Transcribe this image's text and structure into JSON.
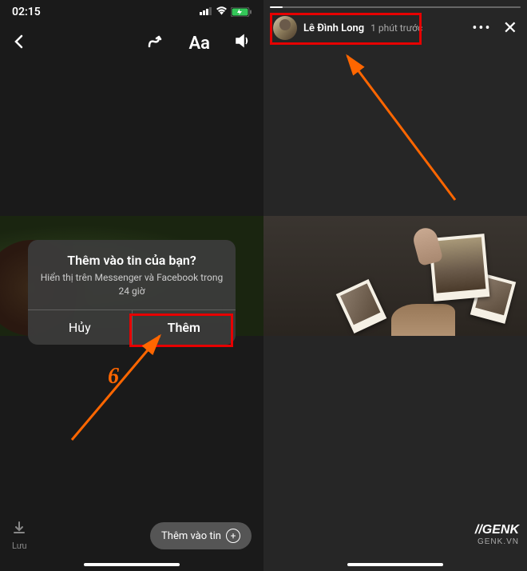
{
  "status_bar": {
    "time": "02:15"
  },
  "toolbar": {
    "text_icon": "Aa"
  },
  "dialog": {
    "title": "Thêm vào tin của bạn?",
    "subtitle": "Hiển thị trên Messenger và Facebook trong 24 giờ",
    "cancel": "Hủy",
    "confirm": "Thêm"
  },
  "step": {
    "number": "6"
  },
  "bottom": {
    "save": "Lưu",
    "add_story": "Thêm vào tin"
  },
  "story": {
    "user_name": "Lê Đình Long",
    "time_ago": "1 phút trước"
  },
  "watermark": {
    "main": "//GENK",
    "sub": "GENK.VN"
  }
}
